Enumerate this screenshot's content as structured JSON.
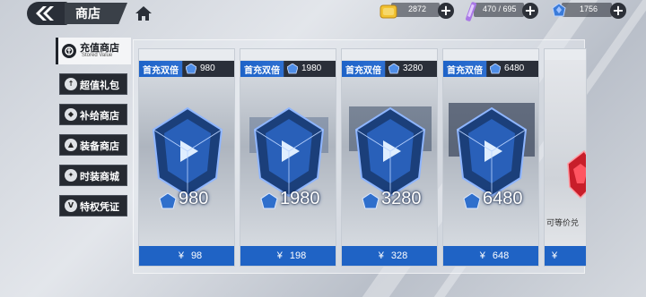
{
  "header": {
    "title": "商店"
  },
  "resources": [
    {
      "name": "coin",
      "value": "2872",
      "color": "#f2c230"
    },
    {
      "name": "stamina",
      "value": "470 / 695",
      "color": "#a978e6"
    },
    {
      "name": "crystal",
      "value": "1756",
      "color": "#3a7bd9"
    }
  ],
  "sidebar": {
    "active": {
      "label": "充值商店",
      "sub": "Stored Value"
    },
    "items": [
      {
        "label": "超值礼包",
        "icon": "gift-icon"
      },
      {
        "label": "补给商店",
        "icon": "supply-icon"
      },
      {
        "label": "装备商店",
        "icon": "equipment-icon"
      },
      {
        "label": "时装商城",
        "icon": "fashion-icon"
      },
      {
        "label": "特权凭证",
        "icon": "privilege-icon"
      }
    ]
  },
  "cards": [
    {
      "tag": "首充双倍",
      "bonus": "980",
      "amount": "980",
      "price_symbol": "¥",
      "price": "98"
    },
    {
      "tag": "首充双倍",
      "bonus": "1980",
      "amount": "1980",
      "price_symbol": "¥",
      "price": "198"
    },
    {
      "tag": "首充双倍",
      "bonus": "3280",
      "amount": "3280",
      "price_symbol": "¥",
      "price": "328"
    },
    {
      "tag": "首充双倍",
      "bonus": "6480",
      "amount": "6480",
      "price_symbol": "¥",
      "price": "648"
    }
  ],
  "partial_card": {
    "text": "可等价兑",
    "price_symbol": "¥"
  },
  "colors": {
    "accent_blue": "#1f63c5",
    "dark": "#262a31"
  }
}
